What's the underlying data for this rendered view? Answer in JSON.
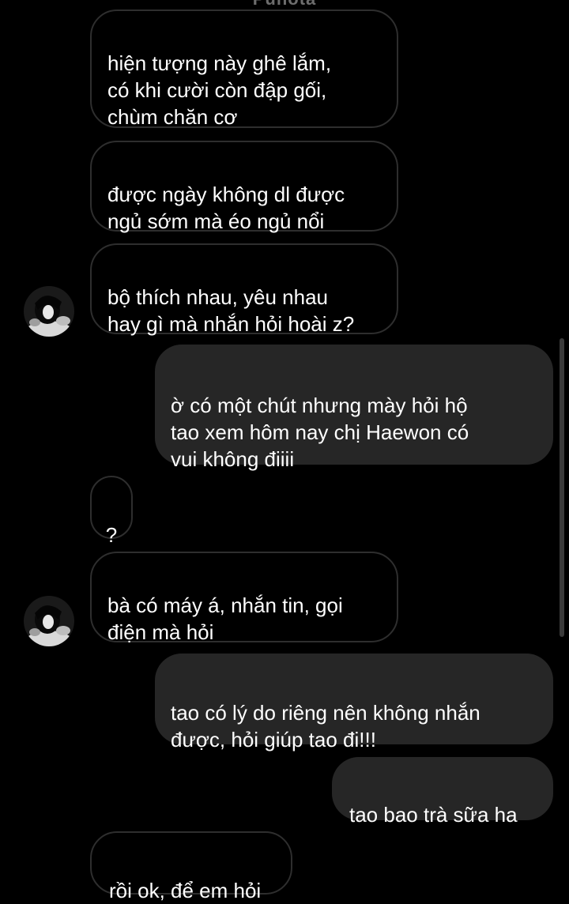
{
  "conversation": {
    "header_cut_text": "Punota",
    "messages": [
      {
        "direction": "in",
        "text": "hiện tượng này ghê lắm,\ncó khi cười còn đập gối,\nchùm chăn cơ"
      },
      {
        "direction": "in",
        "text": "được ngày không dl được\nngủ sớm mà éo ngủ nổi"
      },
      {
        "direction": "in",
        "text": "bộ thích nhau, yêu nhau\nhay gì mà nhắn hỏi hoài z?"
      },
      {
        "direction": "out",
        "text": "ờ có một chút nhưng mày hỏi hộ\ntao xem hôm nay chị Haewon có\nvui không điiii"
      },
      {
        "direction": "in",
        "text": "?"
      },
      {
        "direction": "in",
        "text": "bà có máy á, nhắn tin, gọi\nđiện mà hỏi"
      },
      {
        "direction": "out",
        "text": "tao có lý do riêng nên không nhắn\nđược, hỏi giúp tao đi!!!"
      },
      {
        "direction": "out",
        "text": "tao bao trà sữa ha"
      },
      {
        "direction": "in",
        "text": "rồi ok, để em hỏi"
      }
    ]
  },
  "colors": {
    "background": "#000000",
    "incoming_border": "#2e2e2e",
    "outgoing_bubble": "#262626",
    "text": "#ffffff"
  },
  "icons": {
    "avatar": "contact-avatar"
  }
}
